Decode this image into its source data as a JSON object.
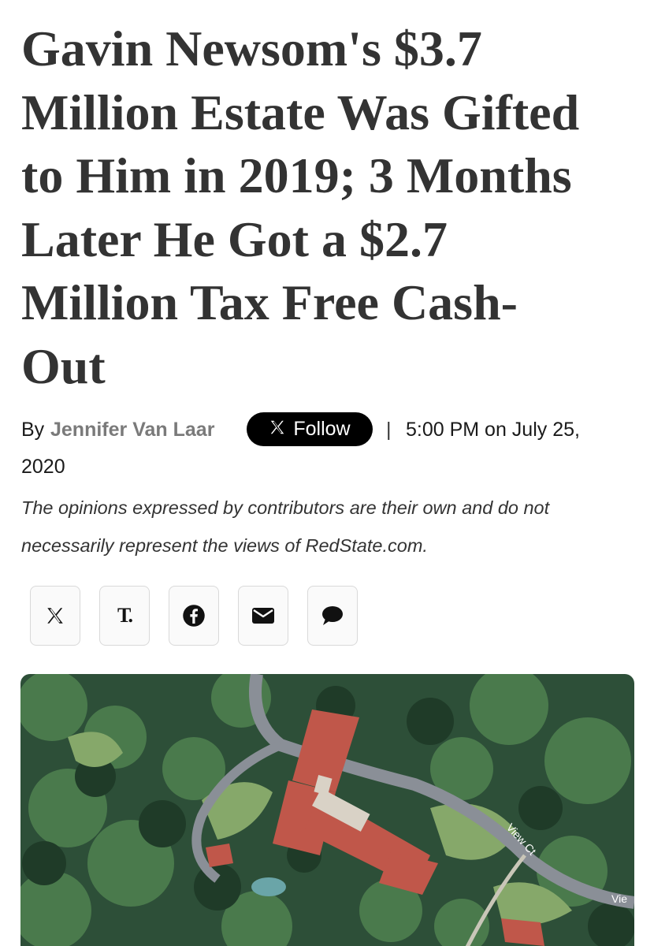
{
  "article": {
    "headline_lines": [
      "Gavin Newsom's $3.7",
      "Million Estate Was Gifted",
      "to Him in 2019; 3 Months",
      "Later He Got a $2.7",
      "Million Tax Free Cash-",
      "Out"
    ],
    "byline": {
      "by_label": "By",
      "author": "Jennifer Van Laar",
      "follow_label": "Follow",
      "separator": "|",
      "date_line": "5:00 PM on July 25,",
      "date_year": "2020"
    },
    "disclaimer_lines": [
      "The opinions expressed by contributors are their own and do not",
      "necessarily represent the views of RedState.com."
    ]
  },
  "share": {
    "buttons": [
      {
        "name": "x-share",
        "icon": "x-icon"
      },
      {
        "name": "truth-social-share",
        "icon": "truth-social-icon",
        "glyph": "T."
      },
      {
        "name": "facebook-share",
        "icon": "facebook-icon"
      },
      {
        "name": "email-share",
        "icon": "envelope-icon"
      },
      {
        "name": "comments",
        "icon": "comment-bubble-icon"
      }
    ]
  },
  "hero_image": {
    "description": "aerial satellite view of estate with red tile roof among trees",
    "map_labels": [
      "View Ct",
      "Vie"
    ]
  },
  "colors": {
    "headline": "#333333",
    "author": "#7a7a7a",
    "follow_button": "#000000",
    "share_border": "#d9d9d9",
    "roof": "#c0574a",
    "foliage": "#2f5a3a"
  }
}
